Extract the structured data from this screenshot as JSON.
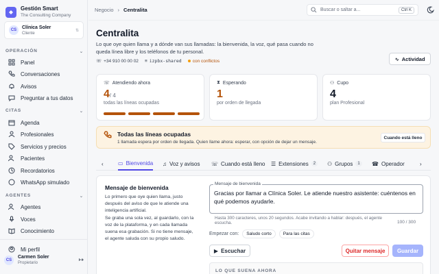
{
  "brand": {
    "title": "Gestión Smart",
    "subtitle": "The Consulting Company"
  },
  "client": {
    "initials": "CS",
    "name": "Clínica Soler",
    "role": "Cliente"
  },
  "sidebar": {
    "operacion": {
      "label": "OPERACIÓN",
      "items": [
        "Panel",
        "Conversaciones",
        "Avisos",
        "Preguntar a tus datos"
      ]
    },
    "citas": {
      "label": "CITAS",
      "items": [
        "Agenda",
        "Profesionales",
        "Servicios y precios",
        "Pacientes",
        "Recordatorios",
        "WhatsApp simulado"
      ]
    },
    "agentes": {
      "label": "AGENTES",
      "items": [
        "Agentes",
        "Voces",
        "Conocimiento"
      ]
    },
    "profile": "Mi perfil",
    "user": {
      "initials": "CS",
      "name": "Carmen Soler",
      "role": "Propietario"
    }
  },
  "breadcrumb": {
    "parent": "Negocio",
    "current": "Centralita"
  },
  "search": {
    "placeholder": "Buscar o saltar a...",
    "shortcut": "Ctrl K"
  },
  "page": {
    "title": "Centralita",
    "description": "Lo que oye quien llama y a dónde van sus llamadas: la bienvenida, la voz, qué pasa cuando no queda línea libre y los teléfonos de tu personal.",
    "phone": "+34 910 00 00 02",
    "trunk": "izpbx-shared",
    "status": "con conflictos",
    "activity": "Actividad"
  },
  "stats": {
    "attending": {
      "label": "Atendiendo ahora",
      "value": "4",
      "total": "/ 4",
      "sub": "todas las líneas ocupadas",
      "lines_busy": 4
    },
    "waiting": {
      "label": "Esperando",
      "value": "1",
      "sub": "por orden de llegada"
    },
    "quota": {
      "label": "Cupo",
      "value": "4",
      "sub": "plan Profesional"
    }
  },
  "alert": {
    "title": "Todas las líneas ocupadas",
    "text": "1 llamada espera por orden de llegada. Quien llame ahora: esperar, con opción de dejar un mensaje.",
    "button": "Cuando está lleno"
  },
  "tabs": [
    {
      "label": "Bienvenida",
      "active": true
    },
    {
      "label": "Voz y avisos"
    },
    {
      "label": "Cuando está lleno"
    },
    {
      "label": "Extensiones",
      "count": "2"
    },
    {
      "label": "Grupos",
      "count": "1"
    },
    {
      "label": "Operador"
    }
  ],
  "welcome": {
    "title": "Mensaje de bienvenida",
    "p1": "Lo primero que oye quien llama, justo después del aviso de que le atiende una inteligencia artificial.",
    "p2": "Se graba una sola vez, al guardarlo, con la voz de la plataforma, y en cada llamada suena esa grabación. Si no tiene mensaje, el agente saluda con su propio saludo.",
    "field_label": "Mensaje de bienvenida",
    "field_value": "Gracias por llamar a Clínica Soler. Le atiende nuestro asistente: cuéntenos en qué podemos ayudarle.",
    "hint": "Hasta 300 caracteres, unos 20 segundos. Acabe invitando a hablar: después, el agente escucha.",
    "counter": "100 / 300",
    "start_label": "Empezar con:",
    "chips": [
      "Saludo corto",
      "Para las citas"
    ],
    "listen": "Escuchar",
    "remove": "Quitar mensaje",
    "save": "Guardar",
    "sounds": "LO QUE SUENA AHORA"
  },
  "colors": {
    "accent": "#4f46e5",
    "warning": "#b45309",
    "danger": "#dc2626"
  }
}
